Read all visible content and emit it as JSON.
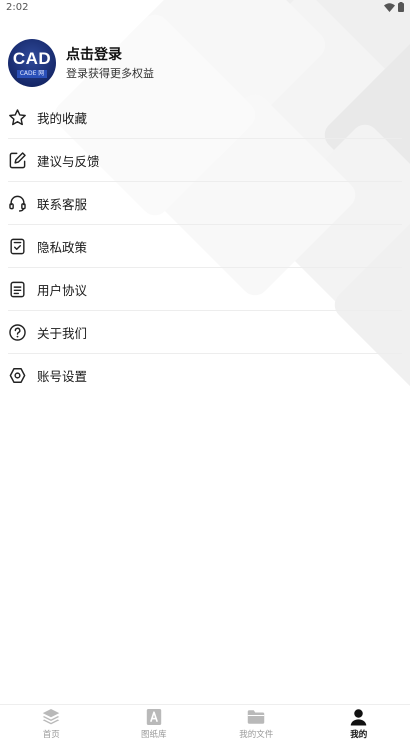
{
  "status_bar": {
    "time": "2:02"
  },
  "profile": {
    "avatar_logo": "CAD",
    "avatar_sub": "CADE 网",
    "title": "点击登录",
    "subtitle": "登录获得更多权益"
  },
  "menu": {
    "items": [
      {
        "label": "我的收藏",
        "icon": "star-icon"
      },
      {
        "label": "建议与反馈",
        "icon": "edit-icon"
      },
      {
        "label": "联系客服",
        "icon": "headset-icon"
      },
      {
        "label": "隐私政策",
        "icon": "privacy-icon"
      },
      {
        "label": "用户协议",
        "icon": "document-icon"
      },
      {
        "label": "关于我们",
        "icon": "question-icon"
      },
      {
        "label": "账号设置",
        "icon": "settings-icon"
      }
    ]
  },
  "tab_bar": {
    "tabs": [
      {
        "label": "首页",
        "icon": "layers-icon"
      },
      {
        "label": "图纸库",
        "icon": "drawing-icon"
      },
      {
        "label": "我的文件",
        "icon": "folder-icon"
      },
      {
        "label": "我的",
        "icon": "person-icon",
        "active": true
      }
    ]
  },
  "colors": {
    "accent": "#111111",
    "inactive": "#9a9a9a",
    "divider": "#ededed"
  }
}
